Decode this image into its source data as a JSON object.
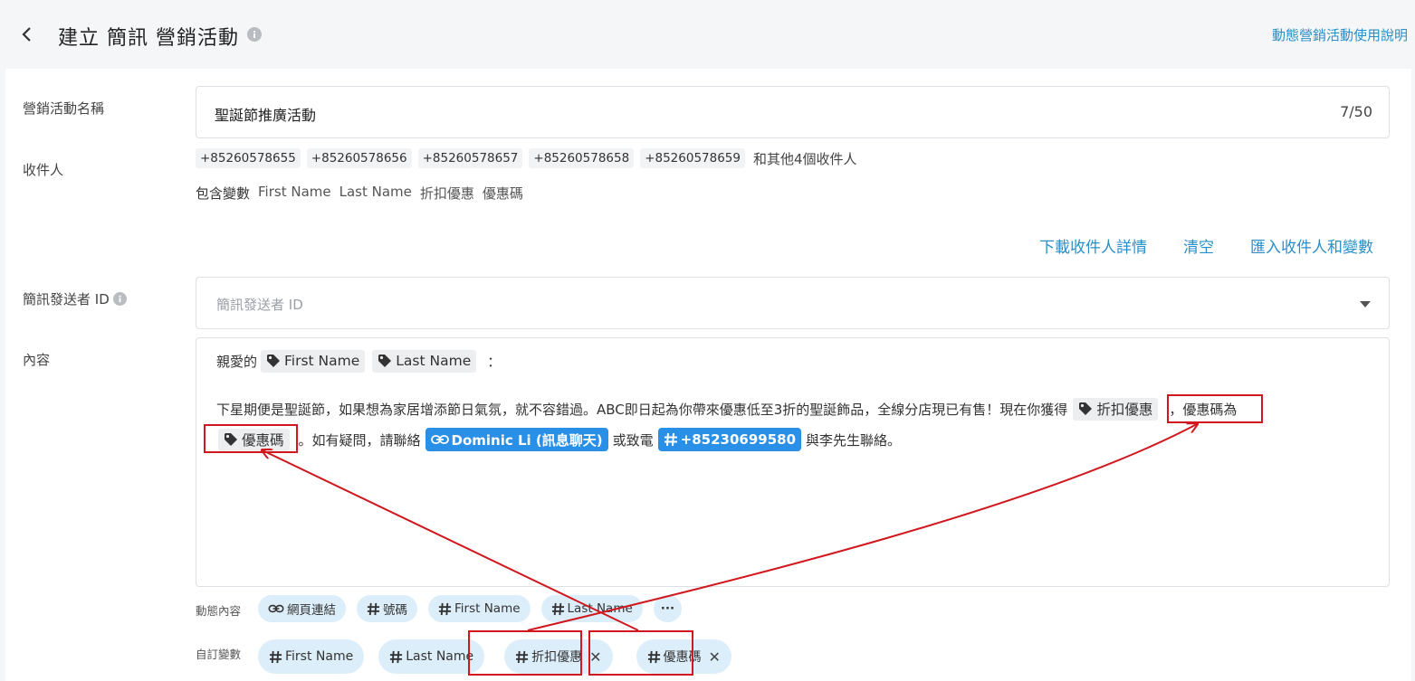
{
  "header": {
    "title": "建立 簡訊 營銷活動",
    "help_link": "動態營銷活動使用說明"
  },
  "form": {
    "campaign_name": {
      "label": "營銷活動名稱",
      "value": "聖誕節推廣活動",
      "counter": "7/50"
    },
    "recipients": {
      "label": "收件人",
      "phones": [
        "+85260578655",
        "+85260578656",
        "+85260578657",
        "+85260578658",
        "+85260578659"
      ],
      "more": "和其他4個收件人",
      "vars_prefix": "包含變數",
      "vars": [
        "First Name",
        "Last Name",
        "折扣優惠",
        "優惠碼"
      ],
      "actions": {
        "download": "下載收件人詳情",
        "clear": "清空",
        "import": "匯入收件人和變數"
      }
    },
    "sender_id": {
      "label": "簡訊發送者 ID",
      "placeholder": "簡訊發送者 ID"
    },
    "content": {
      "label": "內容",
      "line1_prefix": "親愛的",
      "line1_suffix": "：",
      "tag_first_name": "First Name",
      "tag_last_name": "Last Name",
      "line2_text": "下星期便是聖誕節，如果想為家居增添節日氣氛，就不容錯過。ABC即日起為你帶來優惠低至3折的聖誕飾品，全線分店現已有售！現在你獲得",
      "tag_discount": "折扣優惠",
      "line2_suffix": "，優惠碼為",
      "tag_code": "優惠碼",
      "line3_text1": "。如有疑問，請聯絡",
      "chat_chip": "Dominic Li (訊息聊天)",
      "line3_text2": "或致電",
      "phone_chip": "+85230699580",
      "line3_text3": "與李先生聯絡。"
    },
    "dynamic_content": {
      "label": "動態內容",
      "items": [
        "網頁連結",
        "號碼",
        "First Name",
        "Last Name"
      ],
      "more": "···"
    },
    "custom_vars": {
      "label": "自訂變數",
      "items": [
        "First Name",
        "Last Name",
        "折扣優惠",
        "優惠碼"
      ],
      "close": "✕"
    }
  },
  "colors": {
    "link": "#2a8fc7",
    "accent_chip": "#2a8fe6",
    "pill": "#dceefa",
    "annotation": "#d0181e"
  }
}
